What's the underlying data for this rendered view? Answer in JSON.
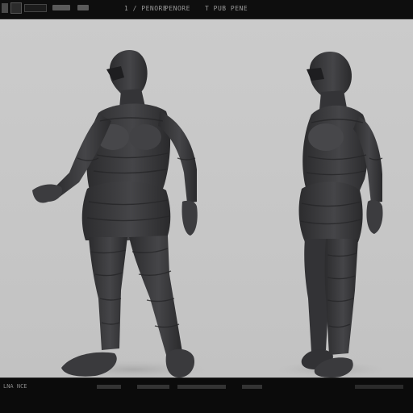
{
  "toolbar": {
    "menu_items": [
      "1 / PENORE",
      "PENORE",
      "T PUB PENE"
    ]
  },
  "statusbar": {
    "text": "LNA NCE"
  },
  "viewport": {
    "background": "#c8c8c8",
    "figure_color": "#3a3a3c"
  }
}
